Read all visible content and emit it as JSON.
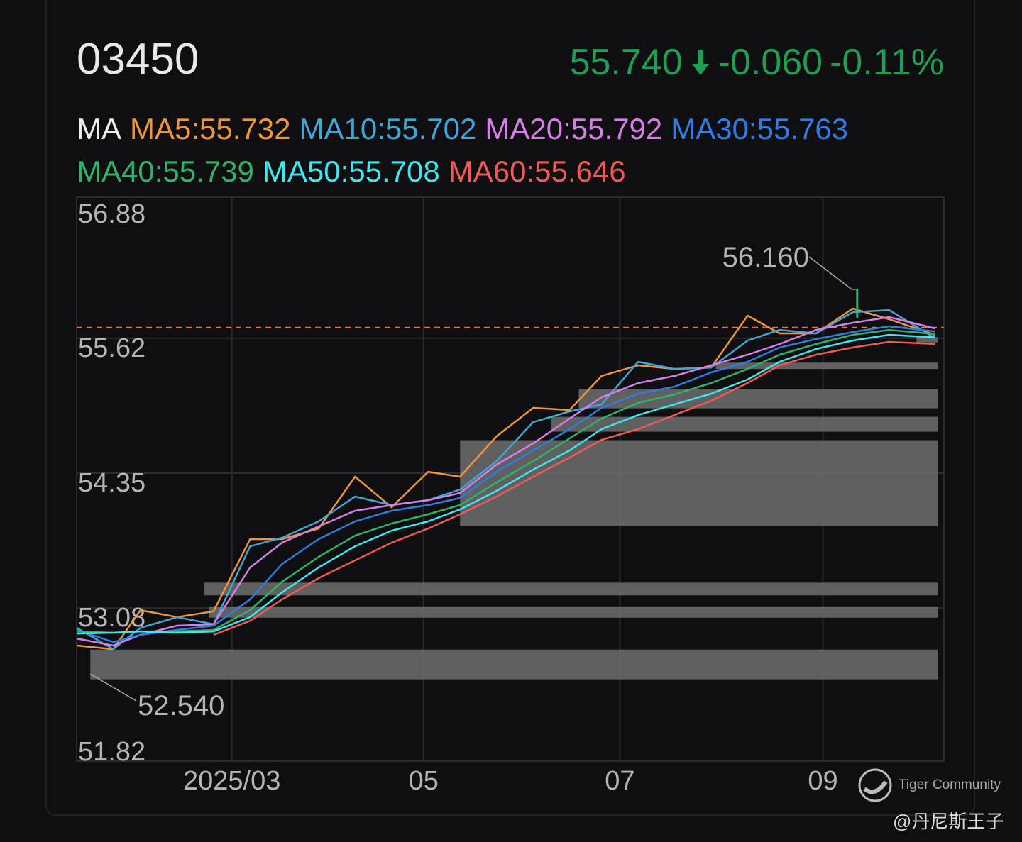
{
  "header": {
    "ticker": "03450",
    "price": "55.740",
    "change": "-0.060",
    "change_pct": "-0.11%",
    "direction_icon": "arrow-down-icon"
  },
  "ma_legend": {
    "title": "MA",
    "items": [
      {
        "label": "MA5:55.732",
        "color": "#f0953a"
      },
      {
        "label": "MA10:55.702",
        "color": "#3fa7d6"
      },
      {
        "label": "MA20:55.792",
        "color": "#d77ee8"
      },
      {
        "label": "MA30:55.763",
        "color": "#2f7de0"
      },
      {
        "label": "MA40:55.739",
        "color": "#2fb36a"
      },
      {
        "label": "MA50:55.708",
        "color": "#3ee6ee"
      },
      {
        "label": "MA60:55.646",
        "color": "#ee5a55"
      }
    ]
  },
  "watermark": {
    "brand": "Tiger Community",
    "user": "@丹尼斯王子"
  },
  "chart_data": {
    "type": "line",
    "title": "03450 MA",
    "xlabel": "",
    "ylabel": "",
    "ylim": [
      51.82,
      56.88
    ],
    "xlim": [
      0,
      190
    ],
    "y_ticks": [
      "56.88",
      "55.62",
      "54.35",
      "53.08",
      "51.82"
    ],
    "y_tick_values": [
      56.88,
      55.62,
      54.35,
      53.08,
      51.82
    ],
    "x_ticks": [
      {
        "label": "2025/03",
        "x": 34
      },
      {
        "label": "05",
        "x": 76
      },
      {
        "label": "07",
        "x": 119
      },
      {
        "label": "09",
        "x": 163.5
      }
    ],
    "grid": true,
    "reference_line": {
      "value": 55.8,
      "color": "#e07a30",
      "style": "dashed"
    },
    "annotations": [
      {
        "label": "56.160",
        "x": 171,
        "y": 56.16,
        "type": "high"
      },
      {
        "label": "52.540",
        "x": 3,
        "y": 52.54,
        "type": "low"
      }
    ],
    "x": [
      0,
      8,
      14,
      22,
      30,
      38,
      45,
      53,
      61,
      69,
      77,
      84,
      92,
      100,
      108,
      115,
      123,
      131,
      139,
      147,
      154,
      162,
      170,
      178,
      188
    ],
    "series": [
      {
        "name": "MA5",
        "color": "#f0953a",
        "values": [
          52.808,
          52.774,
          53.141,
          53.075,
          53.13,
          53.809,
          53.809,
          53.909,
          54.397,
          54.109,
          54.443,
          54.397,
          54.777,
          55.044,
          55.024,
          55.345,
          55.445,
          55.411,
          55.424,
          55.912,
          55.745,
          55.745,
          55.979,
          55.879,
          55.732
        ]
      },
      {
        "name": "MA10",
        "color": "#3fa7d6",
        "values": [
          52.975,
          52.774,
          52.975,
          53.075,
          53.008,
          53.742,
          53.822,
          53.976,
          54.21,
          54.13,
          54.176,
          54.276,
          54.543,
          54.91,
          55.011,
          55.077,
          55.478,
          55.411,
          55.424,
          55.678,
          55.778,
          55.745,
          55.945,
          55.965,
          55.702
        ]
      },
      {
        "name": "MA20",
        "color": "#d77ee8",
        "values": [
          52.874,
          52.808,
          52.908,
          52.995,
          53.008,
          53.542,
          53.776,
          53.929,
          54.076,
          54.13,
          54.176,
          54.243,
          54.51,
          54.71,
          54.944,
          55.144,
          55.278,
          55.345,
          55.445,
          55.545,
          55.645,
          55.778,
          55.845,
          55.899,
          55.792
        ]
      },
      {
        "name": "MA30",
        "color": "#2f7de0",
        "values": [
          52.955,
          52.841,
          52.908,
          52.955,
          52.995,
          53.242,
          53.575,
          53.809,
          53.976,
          54.076,
          54.13,
          54.196,
          54.443,
          54.644,
          54.844,
          55.044,
          55.178,
          55.244,
          55.378,
          55.478,
          55.612,
          55.692,
          55.758,
          55.812,
          55.763
        ]
      },
      {
        "name": "MA40",
        "color": "#2fb36a",
        "values": [
          52.941,
          52.928,
          52.941,
          52.941,
          52.955,
          53.141,
          53.408,
          53.642,
          53.842,
          53.956,
          54.043,
          54.13,
          54.343,
          54.543,
          54.757,
          54.944,
          55.091,
          55.171,
          55.278,
          55.411,
          55.545,
          55.645,
          55.732,
          55.778,
          55.739
        ]
      },
      {
        "name": "MA50",
        "color": "#3ee6ee",
        "values": [
          52.921,
          52.928,
          52.941,
          52.928,
          52.941,
          53.075,
          53.308,
          53.542,
          53.742,
          53.889,
          53.976,
          54.089,
          54.263,
          54.463,
          54.644,
          54.844,
          54.977,
          55.077,
          55.178,
          55.311,
          55.478,
          55.598,
          55.678,
          55.732,
          55.708
        ]
      },
      {
        "name": "MA60",
        "color": "#ee5a55",
        "values": [
          null,
          null,
          null,
          null,
          52.908,
          53.041,
          53.242,
          53.442,
          53.609,
          53.776,
          53.909,
          54.043,
          54.21,
          54.397,
          54.577,
          54.744,
          54.844,
          54.977,
          55.111,
          55.278,
          55.445,
          55.545,
          55.612,
          55.665,
          55.646
        ]
      }
    ],
    "price_zones": [
      {
        "from_x": 3,
        "low": 52.49,
        "high": 52.77
      },
      {
        "from_x": 29,
        "low": 53.07,
        "high": 53.17
      },
      {
        "from_x": 28,
        "low": 53.28,
        "high": 53.4
      },
      {
        "from_x": 84,
        "low": 53.93,
        "high": 54.74
      },
      {
        "from_x": 104,
        "low": 54.82,
        "high": 54.96
      },
      {
        "from_x": 110,
        "low": 55.04,
        "high": 55.22
      },
      {
        "from_x": 140,
        "low": 55.41,
        "high": 55.47
      },
      {
        "from_x": 184,
        "low": 55.66,
        "high": 55.71
      }
    ]
  }
}
